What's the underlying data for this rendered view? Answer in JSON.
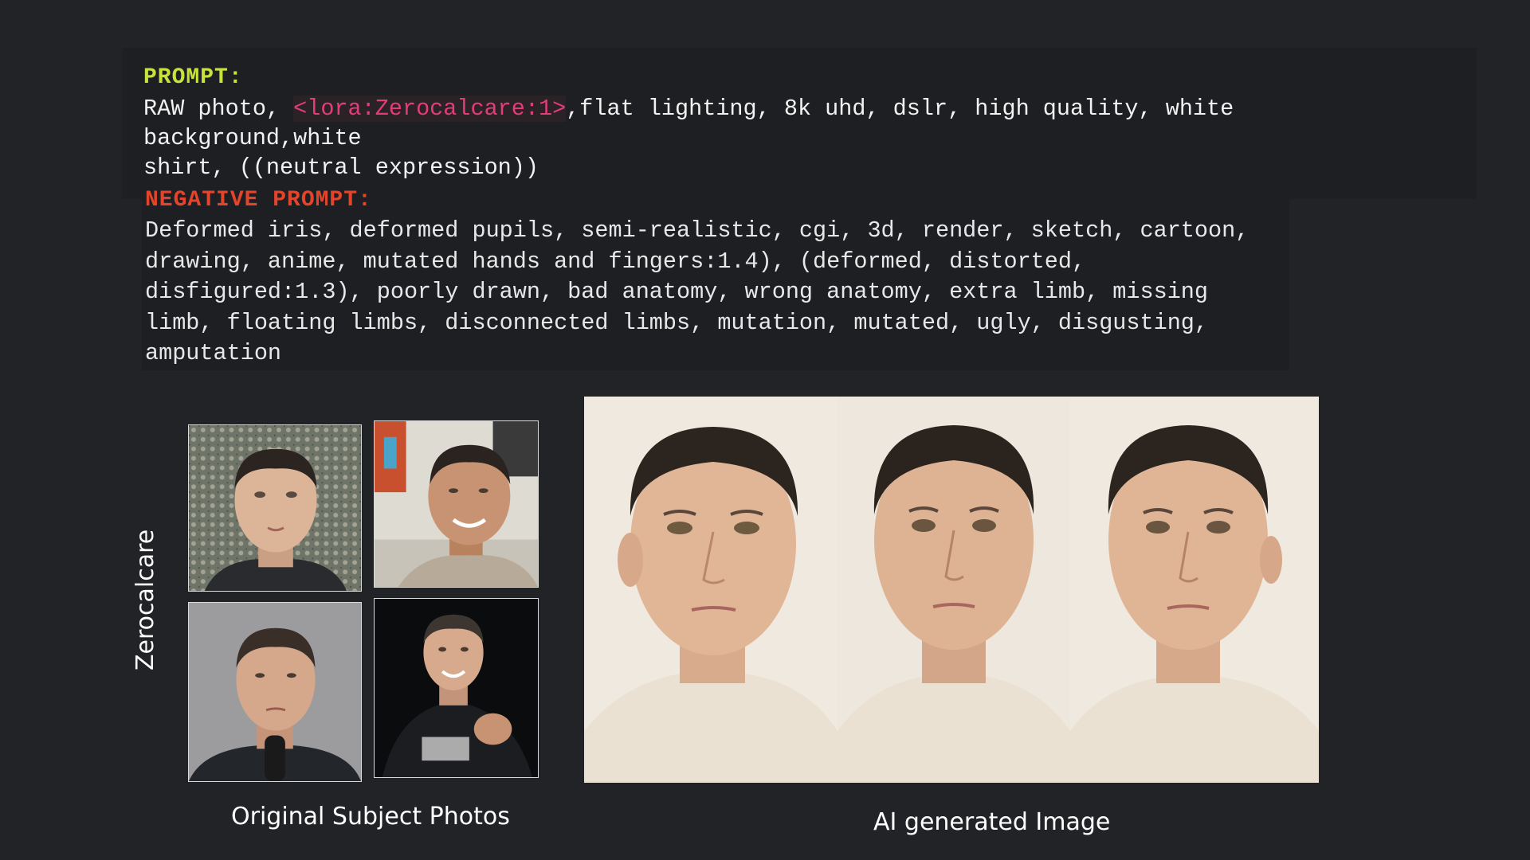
{
  "prompt": {
    "label": "PROMPT:",
    "text_before": "RAW photo, ",
    "lora_tag": "<lora:Zerocalcare:1>",
    "text_after": ",flat lighting, 8k uhd, dslr, high quality, white background,white\nshirt, ((neutral expression))"
  },
  "negative_prompt": {
    "label": "NEGATIVE PROMPT:",
    "text": "Deformed iris, deformed pupils, semi-realistic, cgi, 3d, render, sketch, cartoon,\ndrawing, anime, mutated hands and fingers:1.4), (deformed, distorted,\ndisfigured:1.3), poorly drawn, bad anatomy, wrong anatomy, extra limb, missing\nlimb, floating limbs, disconnected limbs, mutation, mutated, ugly, disgusting,\namputation"
  },
  "subject_label": "Zerocalcare",
  "captions": {
    "original": "Original Subject Photos",
    "ai": "AI generated Image"
  },
  "colors": {
    "background": "#222326",
    "prompt_label": "#c9e23b",
    "negative_label": "#e2452b",
    "lora_tag": "#e23d7a"
  }
}
